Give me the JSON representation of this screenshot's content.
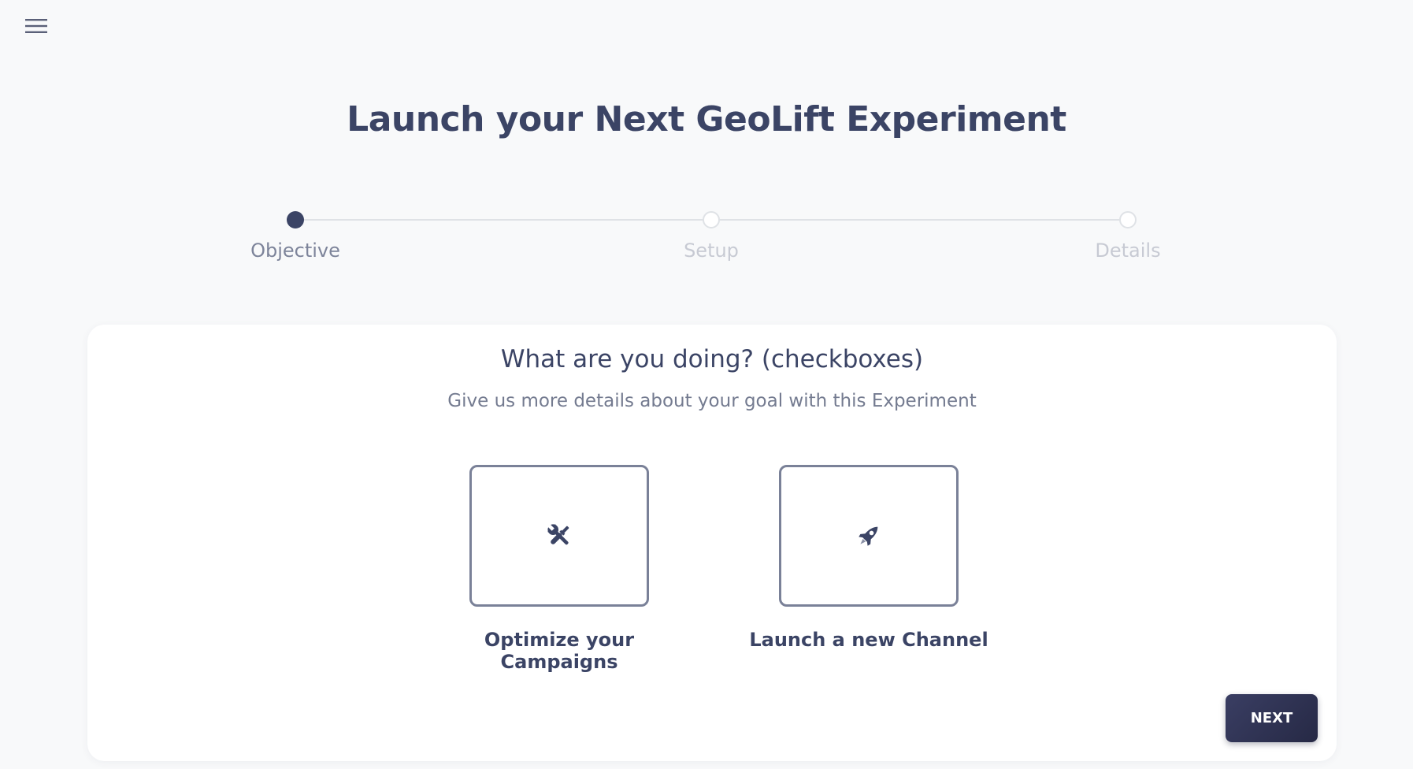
{
  "header": {
    "title": "Launch your Next GeoLift Experiment",
    "menu_icon": "hamburger-menu-icon"
  },
  "stepper": {
    "steps": [
      {
        "label": "Objective",
        "state": "active"
      },
      {
        "label": "Setup",
        "state": "inactive"
      },
      {
        "label": "Details",
        "state": "inactive"
      }
    ]
  },
  "card": {
    "title": "What are you doing? (checkboxes)",
    "subtitle": "Give us more details about your goal with this Experiment",
    "options": [
      {
        "label": "Optimize your Campaigns",
        "icon": "tools-icon"
      },
      {
        "label": "Launch a new Channel",
        "icon": "rocket-icon"
      }
    ],
    "next_label": "NEXT"
  },
  "colors": {
    "primary": "#3b4465",
    "background": "#f8f9fa",
    "card": "#ffffff",
    "button": "#2d3050",
    "inactive": "#c7cad3"
  }
}
